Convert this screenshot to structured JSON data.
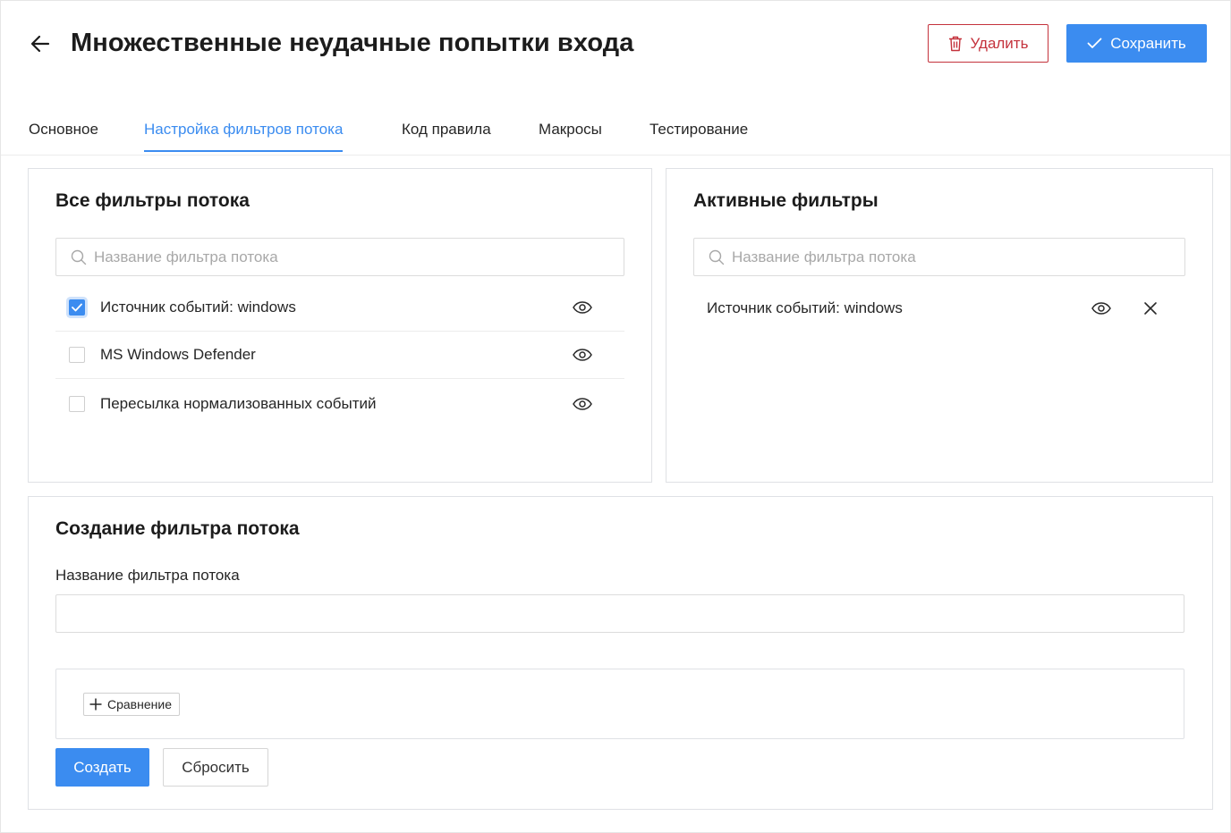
{
  "header": {
    "title": "Множественные неудачные попытки входа",
    "delete_label": "Удалить",
    "save_label": "Сохранить"
  },
  "tabs": [
    {
      "label": "Основное",
      "active": false
    },
    {
      "label": "Настройка фильтров потока",
      "active": true
    },
    {
      "label": "Код правила",
      "active": false
    },
    {
      "label": "Макросы",
      "active": false
    },
    {
      "label": "Тестирование",
      "active": false
    }
  ],
  "all_filters": {
    "title": "Все фильтры потока",
    "search_placeholder": "Название фильтра потока",
    "items": [
      {
        "label": "Источник событий: windows",
        "checked": true
      },
      {
        "label": "MS Windows Defender",
        "checked": false
      },
      {
        "label": "Пересылка нормализованных событий",
        "checked": false
      }
    ]
  },
  "active_filters": {
    "title": "Активные фильтры",
    "search_placeholder": "Название фильтра потока",
    "items": [
      {
        "label": "Источник событий: windows"
      }
    ]
  },
  "create_filter": {
    "title": "Создание фильтра потока",
    "name_label": "Название фильтра потока",
    "name_value": "",
    "compare_label": "Сравнение",
    "create_label": "Создать",
    "reset_label": "Сбросить"
  },
  "colors": {
    "accent": "#3b8cf0",
    "danger": "#c4323c",
    "border": "#dfe1e5"
  },
  "icons": {
    "back": "arrow-left-icon",
    "delete": "trash-icon",
    "save": "check-icon",
    "search": "search-icon",
    "preview": "eye-icon",
    "remove": "close-icon",
    "add": "plus-icon"
  }
}
